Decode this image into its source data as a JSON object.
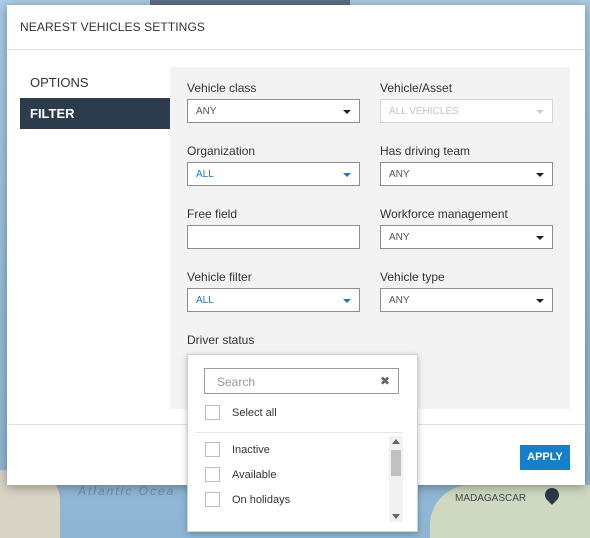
{
  "map": {
    "ocean_label": "Atlantic Ocea",
    "country_label": "MADAGASCAR"
  },
  "modal": {
    "title": "NEAREST VEHICLES SETTINGS",
    "nav": [
      {
        "label": "OPTIONS",
        "active": false
      },
      {
        "label": "FILTER",
        "active": true
      }
    ],
    "apply_label": "APPLY"
  },
  "filters": {
    "vehicle_class": {
      "label": "Vehicle class",
      "value": "ANY"
    },
    "vehicle_asset": {
      "label": "Vehicle/Asset",
      "value": "ALL VEHICLES",
      "disabled": true
    },
    "organization": {
      "label": "Organization",
      "value": "ALL"
    },
    "has_driving_team": {
      "label": "Has driving team",
      "value": "ANY"
    },
    "free_field": {
      "label": "Free field",
      "value": ""
    },
    "workforce_management": {
      "label": "Workforce management",
      "value": "ANY"
    },
    "vehicle_filter": {
      "label": "Vehicle filter",
      "value": "ALL"
    },
    "vehicle_type": {
      "label": "Vehicle type",
      "value": "ANY"
    },
    "driver_status": {
      "label": "Driver status"
    }
  },
  "dropdown": {
    "search_placeholder": "Search",
    "clear_glyph": "✖",
    "select_all_label": "Select all",
    "options": [
      "Inactive",
      "Available",
      "On holidays"
    ]
  },
  "colors": {
    "nav_active_bg": "#2d3c4d",
    "accent_blue": "#1580c9",
    "link_blue": "#1a78c2"
  }
}
